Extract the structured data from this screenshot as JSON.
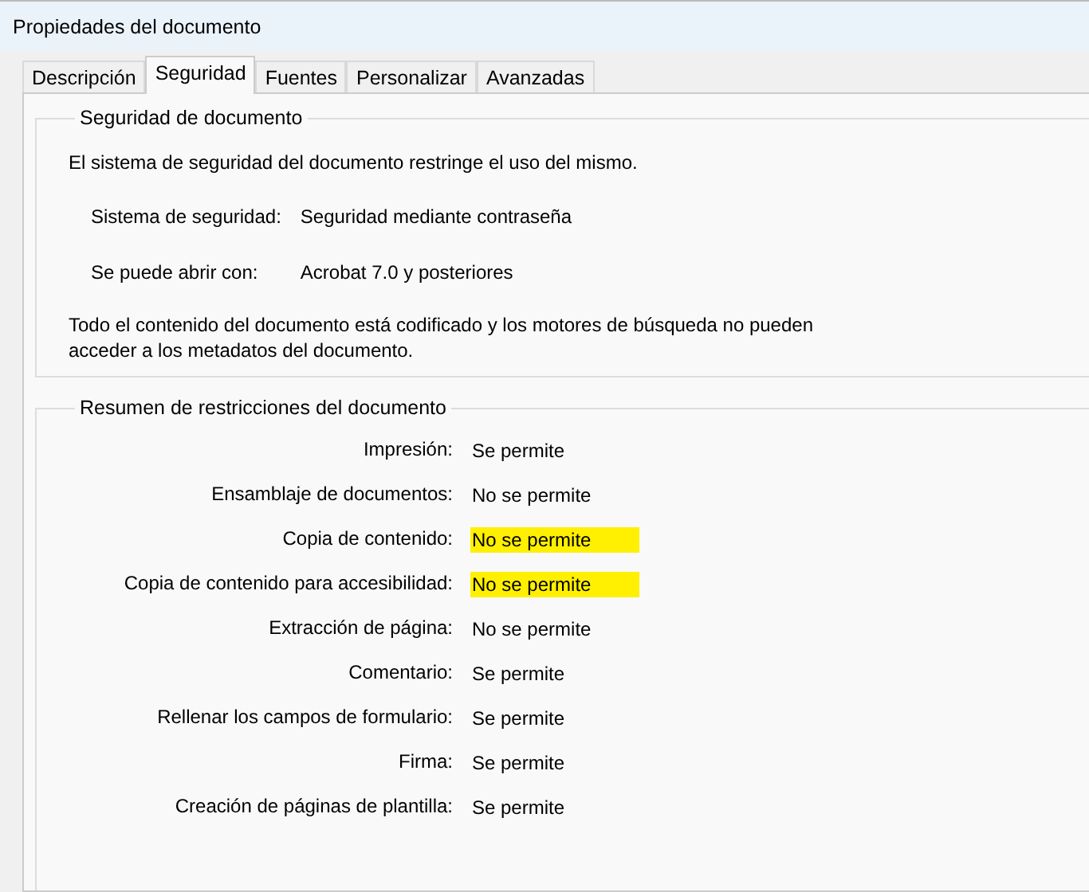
{
  "window": {
    "title": "Propiedades del documento"
  },
  "tabs": [
    {
      "label": "Descripción",
      "selected": false
    },
    {
      "label": "Seguridad",
      "selected": true
    },
    {
      "label": "Fuentes",
      "selected": false
    },
    {
      "label": "Personalizar",
      "selected": false
    },
    {
      "label": "Avanzadas",
      "selected": false
    }
  ],
  "security_group": {
    "title": "Seguridad de documento",
    "intro": "El sistema de seguridad del documento restringe el uso del mismo.",
    "fields": [
      {
        "label": "Sistema de seguridad:",
        "value": "Seguridad mediante contraseña"
      },
      {
        "label": "Se puede abrir con:",
        "value": "Acrobat 7.0 y posteriores"
      }
    ],
    "note": "Todo el contenido del documento está codificado y los motores de búsqueda no pueden acceder a los metadatos del documento."
  },
  "restrictions_group": {
    "title": "Resumen de restricciones del documento",
    "rows": [
      {
        "label": "Impresión:",
        "value": "Se permite",
        "highlighted": false
      },
      {
        "label": "Ensamblaje de documentos:",
        "value": "No se permite",
        "highlighted": false
      },
      {
        "label": "Copia de contenido:",
        "value": "No se permite",
        "highlighted": true
      },
      {
        "label": "Copia de contenido para accesibilidad:",
        "value": "No se permite",
        "highlighted": true
      },
      {
        "label": "Extracción de página:",
        "value": "No se permite",
        "highlighted": false
      },
      {
        "label": "Comentario:",
        "value": "Se permite",
        "highlighted": false
      },
      {
        "label": "Rellenar los campos de formulario:",
        "value": "Se permite",
        "highlighted": false
      },
      {
        "label": "Firma:",
        "value": "Se permite",
        "highlighted": false
      },
      {
        "label": "Creación de páginas de plantilla:",
        "value": "Se permite",
        "highlighted": false
      }
    ]
  }
}
